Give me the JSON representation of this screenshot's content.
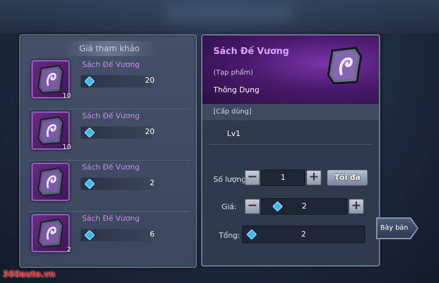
{
  "reference_panel": {
    "title": "Giá tham khảo",
    "items": [
      {
        "name": "Sách Đế Vương",
        "count": "10",
        "price": "20"
      },
      {
        "name": "Sách Đế Vương",
        "count": "10",
        "price": "20"
      },
      {
        "name": "Sách Đế Vương",
        "count": "",
        "price": "2"
      },
      {
        "name": "Sách Đế Vương",
        "count": "2",
        "price": "6"
      }
    ]
  },
  "detail": {
    "name": "Sách Đế Vương",
    "type": "(Tạp phẩm)",
    "quality": "Thông Dụng",
    "level_header": "[Cấp dùng]",
    "level_value": "Lv1"
  },
  "sell_form": {
    "quantity_label": "Số lượng:",
    "quantity_value": "1",
    "max_label": "Tối đa",
    "price_label": "Giá:",
    "price_value": "2",
    "total_label": "Tổng:",
    "total_value": "2"
  },
  "sell_button": {
    "label": "Bày bán"
  },
  "watermark": "360auto.vn",
  "colors": {
    "gem": "#39b7ff",
    "item_name": "#c98cf0",
    "watermark": "#e31b1b"
  }
}
